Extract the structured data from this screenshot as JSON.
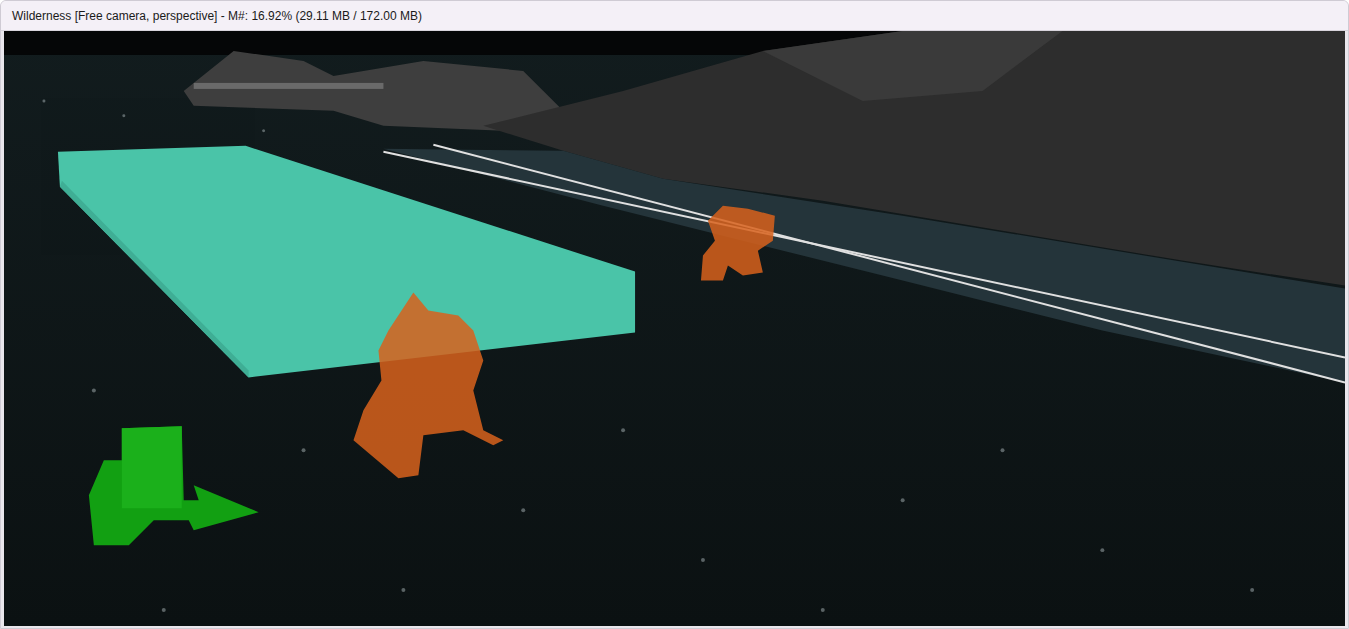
{
  "window": {
    "title": "Wilderness [Free camera, perspective] - M#: 16.92% (29.11 MB / 172.00 MB)"
  }
}
